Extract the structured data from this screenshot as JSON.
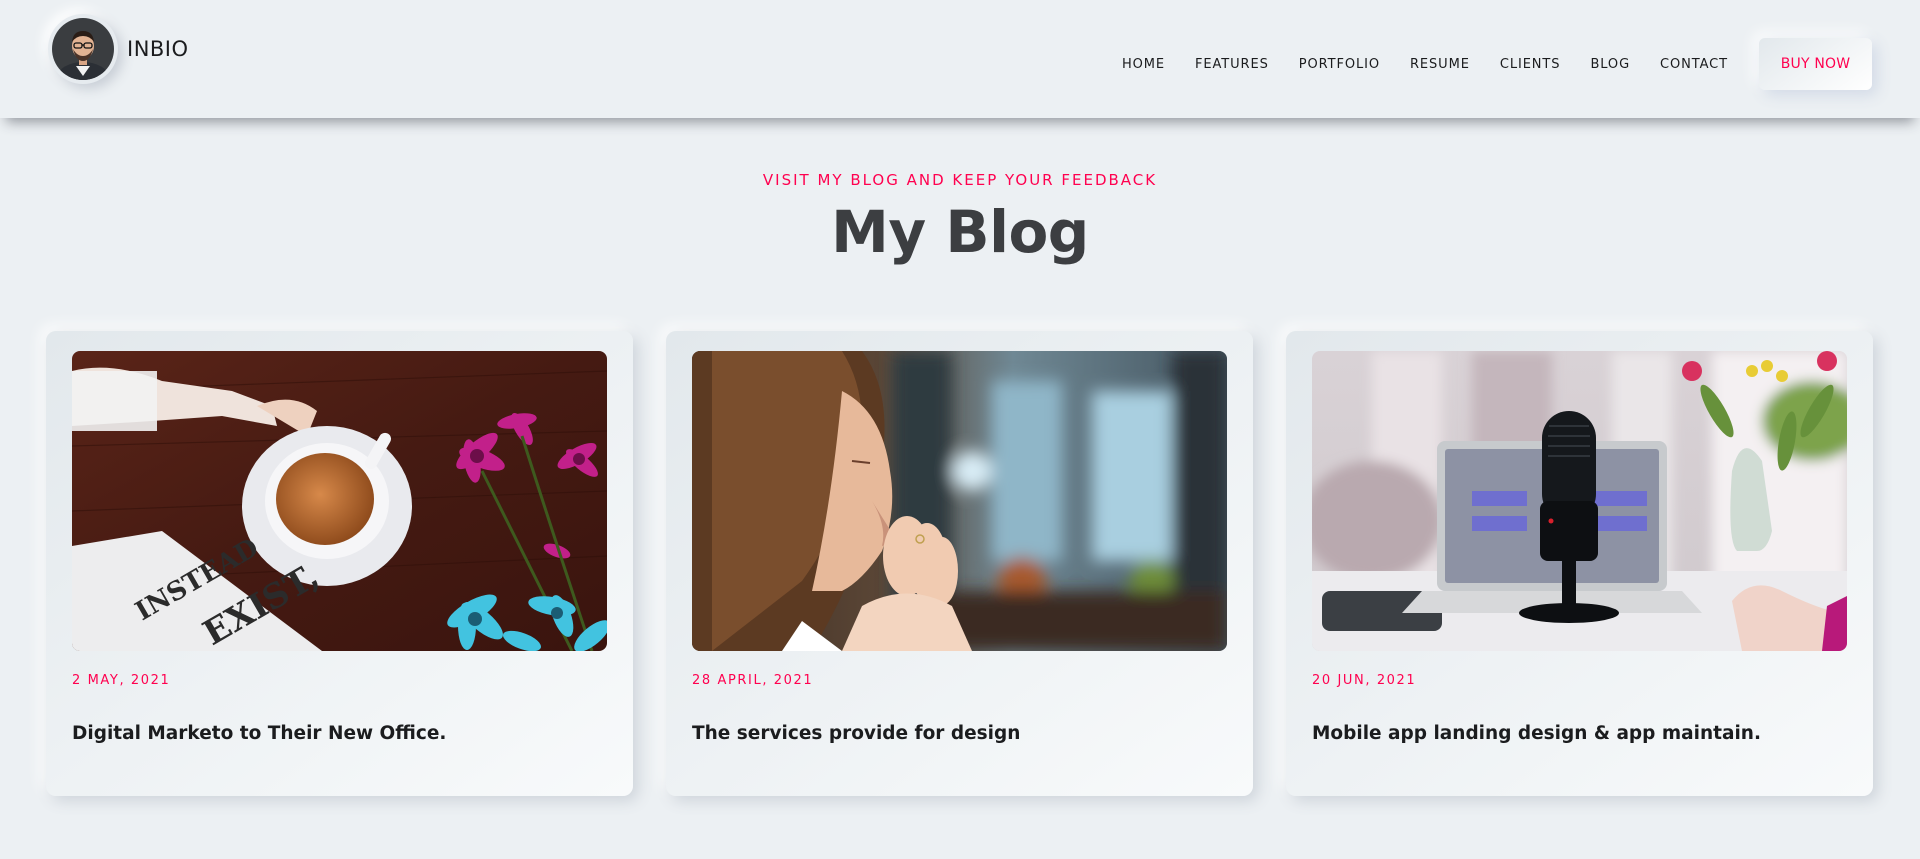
{
  "brand": {
    "name": "INBIO"
  },
  "nav": {
    "items": [
      "HOME",
      "FEATURES",
      "PORTFOLIO",
      "RESUME",
      "CLIENTS",
      "BLOG",
      "CONTACT"
    ],
    "cta_label": "BUY NOW"
  },
  "section": {
    "subtitle": "VISIT MY BLOG AND KEEP YOUR FEEDBACK",
    "title": "My Blog"
  },
  "posts": [
    {
      "date": "2 MAY, 2021",
      "title": "Digital Marketo to Their New Office.",
      "image": "tea-cup-flowers-book"
    },
    {
      "date": "28 APRIL, 2021",
      "title": "The services provide for design",
      "image": "woman-praying"
    },
    {
      "date": "20 JUN, 2021",
      "title": "Mobile app landing design & app maintain.",
      "image": "microphone-laptop"
    }
  ],
  "colors": {
    "accent": "#ff014f",
    "background": "#ecf0f3",
    "text": "#3c3e41"
  }
}
